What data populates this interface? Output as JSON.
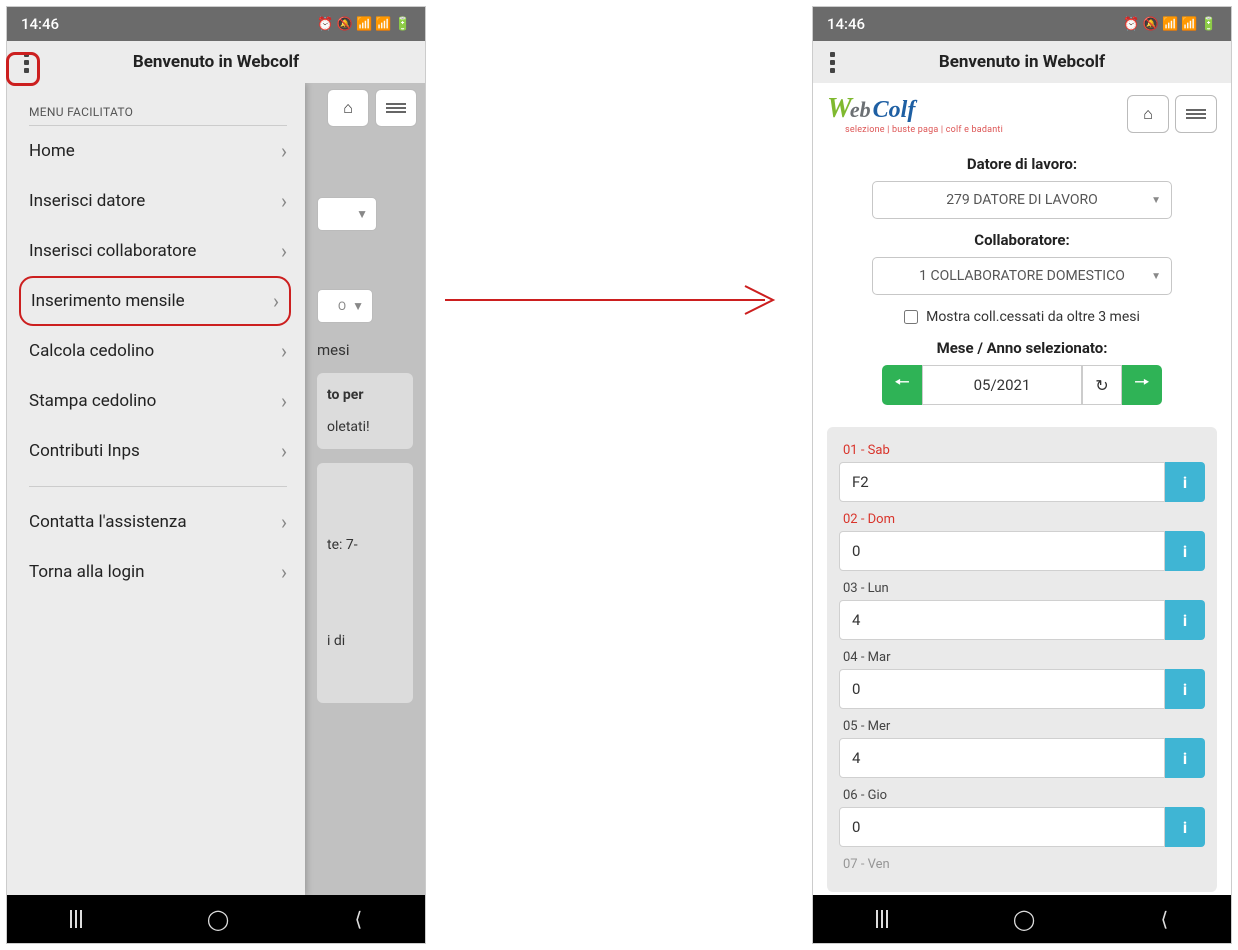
{
  "status": {
    "time": "14:46",
    "icons": "⏰ 🔕 📶 📶 🔋"
  },
  "header": {
    "title": "Benvenuto in Webcolf"
  },
  "sidebar": {
    "section_label": "MENU FACILITATO",
    "items": [
      {
        "label": "Home"
      },
      {
        "label": "Inserisci datore"
      },
      {
        "label": "Inserisci collaboratore"
      },
      {
        "label": "Inserimento mensile",
        "highlight": true
      },
      {
        "label": "Calcola cedolino"
      },
      {
        "label": "Stampa cedolino"
      },
      {
        "label": "Contributi Inps"
      }
    ],
    "footer_items": [
      {
        "label": "Contatta l'assistenza"
      },
      {
        "label": "Torna alla login"
      }
    ]
  },
  "behind": {
    "stub_select_text": "O",
    "stub_text1": "mesi",
    "panel1a": "to per",
    "panel1b": "oletati!",
    "stub_text2": "te: 7-",
    "stub_text3": "i di"
  },
  "logo": {
    "part1": "W",
    "part2": "eb",
    "part3": "Colf",
    "subtitle": "selezione | buste paga | colf e badanti"
  },
  "form": {
    "employer_label": "Datore di lavoro:",
    "employer_value": "279 DATORE DI LAVORO",
    "collaborator_label": "Collaboratore:",
    "collaborator_value": "1 COLLABORATORE DOMESTICO",
    "checkbox_label": "Mostra coll.cessati da oltre 3 mesi",
    "month_label": "Mese / Anno selezionato:",
    "month_value": "05/2021"
  },
  "days": [
    {
      "label": "01 - Sab",
      "value": "F2",
      "weekend": true
    },
    {
      "label": "02 - Dom",
      "value": "0",
      "weekend": true
    },
    {
      "label": "03 - Lun",
      "value": "4",
      "weekend": false
    },
    {
      "label": "04 - Mar",
      "value": "0",
      "weekend": false
    },
    {
      "label": "05 - Mer",
      "value": "4",
      "weekend": false
    },
    {
      "label": "06 - Gio",
      "value": "0",
      "weekend": false
    },
    {
      "label": "07 - Ven",
      "value": "",
      "weekend": false
    }
  ]
}
